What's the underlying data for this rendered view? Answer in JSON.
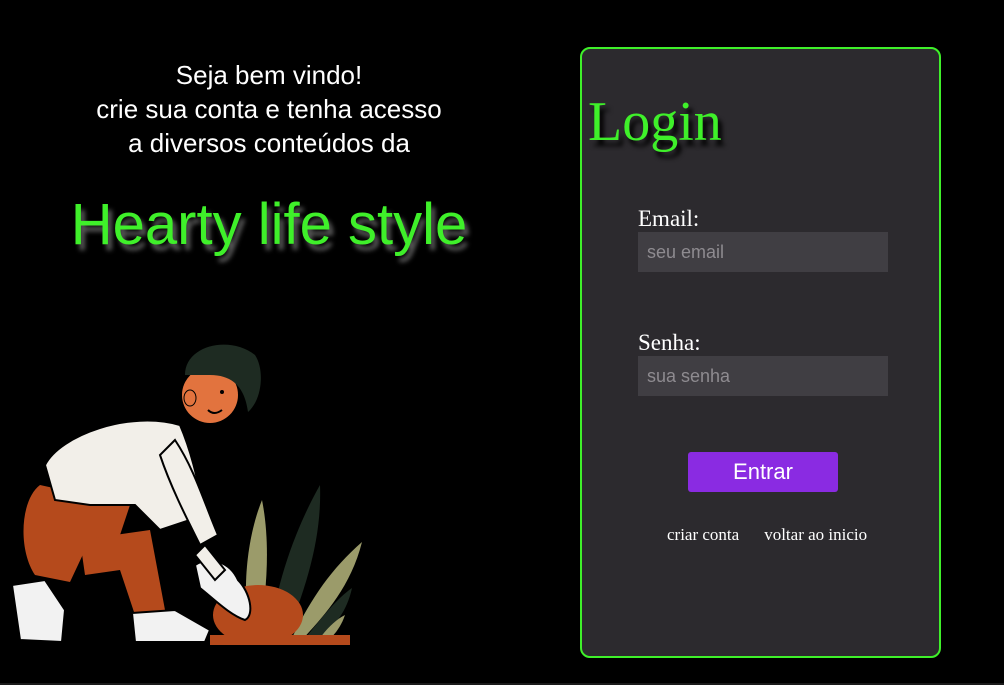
{
  "welcome": {
    "line1": "Seja bem vindo!",
    "line2": "crie sua conta e tenha acesso",
    "line3": "a diversos conteúdos da",
    "brand": "Hearty life style"
  },
  "login": {
    "title": "Login",
    "email_label": "Email:",
    "email_placeholder": "seu email",
    "password_label": "Senha:",
    "password_placeholder": "sua senha",
    "submit_label": "Entrar",
    "create_account_link": "criar conta",
    "back_home_link": "voltar ao inicio"
  },
  "colors": {
    "accent_green": "#3ff02a",
    "button_purple": "#8a2be2",
    "card_bg": "#2c2a2e",
    "input_bg": "#403e43"
  },
  "icons": {
    "illustration": "gardener-planting-illustration"
  }
}
